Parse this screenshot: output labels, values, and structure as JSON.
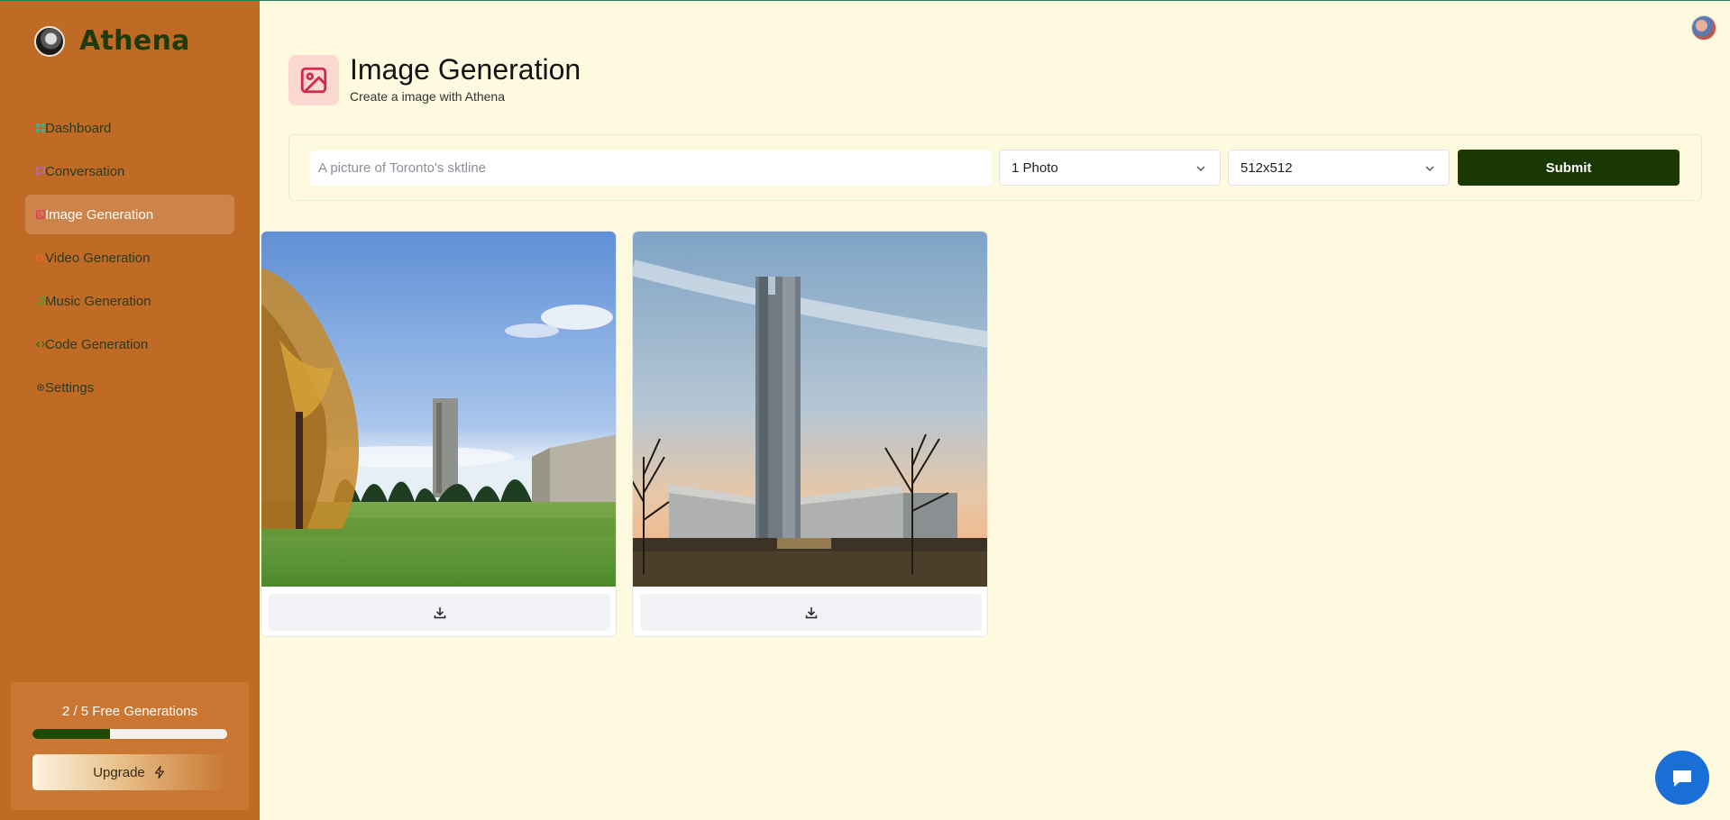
{
  "app": {
    "name": "Athena"
  },
  "sidebar": {
    "items": [
      {
        "label": "Dashboard",
        "icon": "dashboard-icon",
        "color": "#38b28a",
        "active": false
      },
      {
        "label": "Conversation",
        "icon": "message-square-icon",
        "color": "#b268c9",
        "active": false
      },
      {
        "label": "Image Generation",
        "icon": "image-icon",
        "color": "#e0405a",
        "active": true
      },
      {
        "label": "Video Generation",
        "icon": "video-icon",
        "color": "#e8622f",
        "active": false
      },
      {
        "label": "Music Generation",
        "icon": "music-icon",
        "color": "#4d9e2e",
        "active": false
      },
      {
        "label": "Code Generation",
        "icon": "code-icon",
        "color": "#2d6e1e",
        "active": false
      },
      {
        "label": "Settings",
        "icon": "gear-icon",
        "color": "#3a3a3a",
        "active": false
      }
    ]
  },
  "usage": {
    "text": "2 / 5 Free Generations",
    "used": 2,
    "total": 5,
    "upgrade_label": "Upgrade"
  },
  "header": {
    "title": "Image Generation",
    "subtitle": "Create a image with Athena"
  },
  "form": {
    "prompt_placeholder": "A picture of Toronto's sktline",
    "prompt_value": "",
    "count_selected": "1 Photo",
    "size_selected": "512x512",
    "submit_label": "Submit"
  },
  "results": [
    {
      "description": "tower-on-campus-lawn",
      "download_icon": "download-icon"
    },
    {
      "description": "tower-at-sunset",
      "download_icon": "download-icon"
    }
  ],
  "colors": {
    "sidebar_bg": "#bf6b26",
    "main_bg": "#fefadf",
    "accent": "#193804",
    "chat": "#1a6fd6"
  }
}
